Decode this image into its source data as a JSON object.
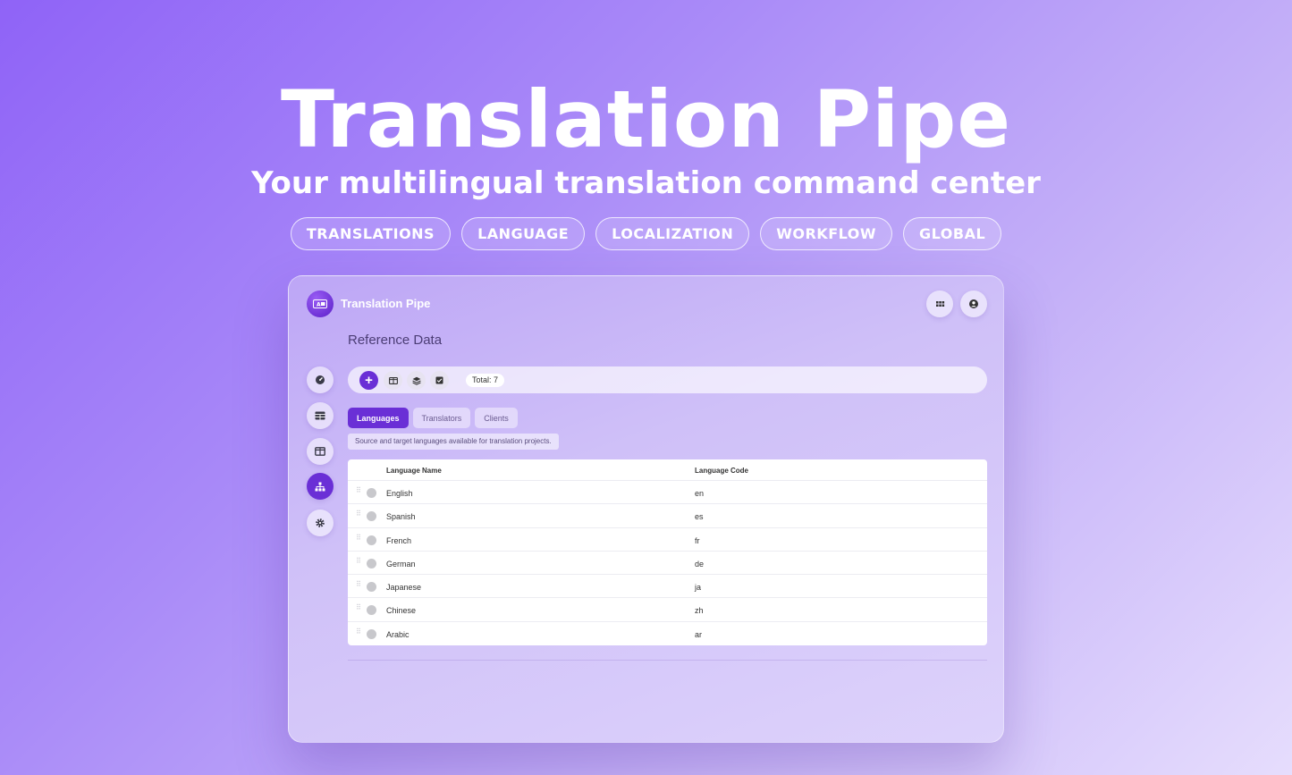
{
  "hero": {
    "title": "Translation Pipe",
    "subtitle": "Your multilingual translation command center",
    "tags": [
      "TRANSLATIONS",
      "LANGUAGE",
      "LOCALIZATION",
      "WORKFLOW",
      "GLOBAL"
    ]
  },
  "app": {
    "name": "Translation Pipe",
    "page_title": "Reference Data",
    "accent_color": "#6a2fd6",
    "header_icons": [
      "grid-icon",
      "user-circle-icon"
    ],
    "sidebar_icons": [
      "dashboard-icon",
      "table-icon",
      "columns-icon",
      "hierarchy-icon",
      "gear-icon"
    ],
    "sidebar_active_index": 3,
    "toolbar": {
      "add_label": "+",
      "icons": [
        "columns-icon",
        "layers-icon",
        "checkbox-icon"
      ],
      "total_label": "Total:",
      "total_value": "7"
    },
    "tabs": [
      {
        "label": "Languages",
        "active": true
      },
      {
        "label": "Translators",
        "active": false
      },
      {
        "label": "Clients",
        "active": false
      }
    ],
    "description": "Source and target languages available for translation projects.",
    "table": {
      "columns": [
        "Language Name",
        "Language Code"
      ],
      "rows": [
        [
          "English",
          "en"
        ],
        [
          "Spanish",
          "es"
        ],
        [
          "French",
          "fr"
        ],
        [
          "German",
          "de"
        ],
        [
          "Japanese",
          "ja"
        ],
        [
          "Chinese",
          "zh"
        ],
        [
          "Arabic",
          "ar"
        ]
      ]
    }
  }
}
